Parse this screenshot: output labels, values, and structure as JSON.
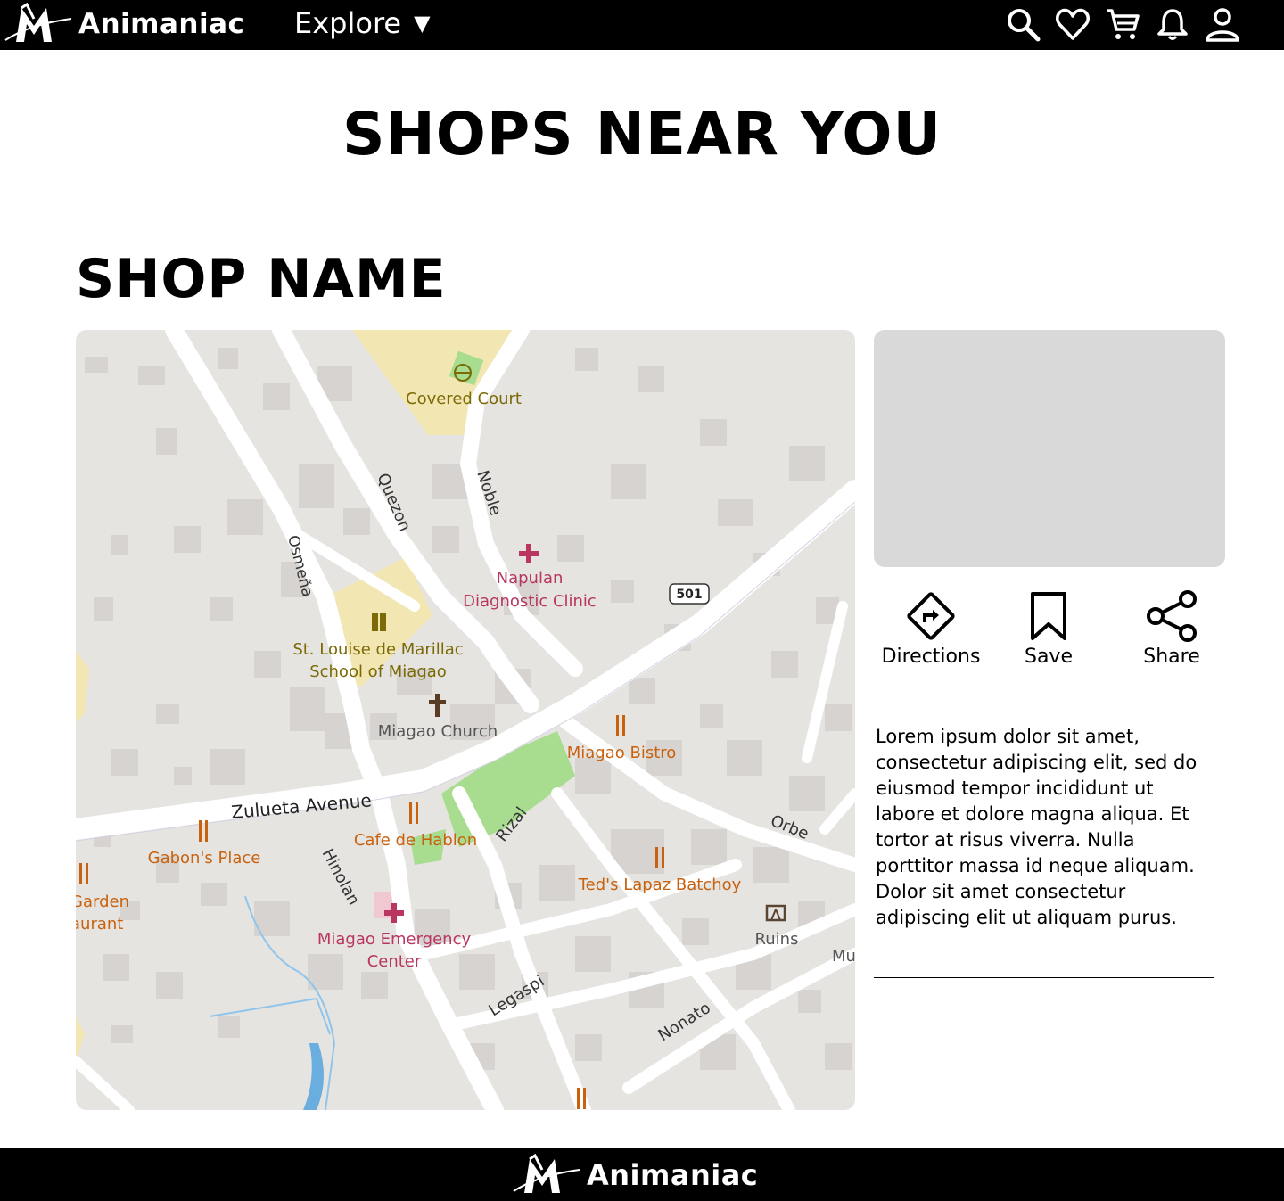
{
  "header": {
    "brand": "Animaniac",
    "explore_label": "Explore",
    "icons": [
      "search-icon",
      "heart-icon",
      "cart-icon",
      "bell-icon",
      "user-icon"
    ]
  },
  "page": {
    "title": "SHOPS NEAR YOU",
    "shop_name": "SHOP NAME"
  },
  "map": {
    "labels": {
      "covered_court": "Covered Court",
      "quezon": "Quezon",
      "noble": "Noble",
      "osmena": "Osmeña",
      "napulan_1": "Napulan",
      "napulan_2": "Diagnostic Clinic",
      "route": "501",
      "school_1": "St. Louise de Marillac",
      "school_2": "School of Miagao",
      "church": "Miagao Church",
      "bistro": "Miagao Bistro",
      "zulueta": "Zulueta Avenue",
      "cafe": "Cafe de Hablon",
      "rizal": "Rizal",
      "orbe": "Orbe",
      "gabon": "Gabon's Place",
      "garden_1": "Garden",
      "garden_2": "aurant",
      "hinolan": "Hinolan",
      "teds": "Ted's Lapaz Batchoy",
      "emergency_1": "Miagao Emergency",
      "emergency_2": "Center",
      "ruins": "Ruins",
      "mu": "Mu",
      "legaspi": "Legaspi",
      "nonato": "Nonato"
    }
  },
  "actions": {
    "directions": "Directions",
    "save": "Save",
    "share": "Share"
  },
  "description": "Lorem ipsum dolor sit amet, consectetur adipiscing elit, sed do eiusmod tempor incididunt ut labore et dolore magna aliqua. Et tortor at risus viverra. Nulla porttitor massa id neque aliquam. Dolor sit amet consectetur adipiscing elit ut aliquam purus.",
  "footer": {
    "brand": "Animaniac"
  },
  "colors": {
    "nav_bg": "#000000",
    "map_bg": "#e6e4e1",
    "road": "#ffffff",
    "building": "#d6d3d0",
    "park": "#a8dc8f",
    "school_area": "#f2e6b3",
    "poi_food": "#c8620f",
    "poi_health": "#b8365f",
    "poi_school": "#7b6a05",
    "photo_placeholder": "#d9d9d9"
  }
}
